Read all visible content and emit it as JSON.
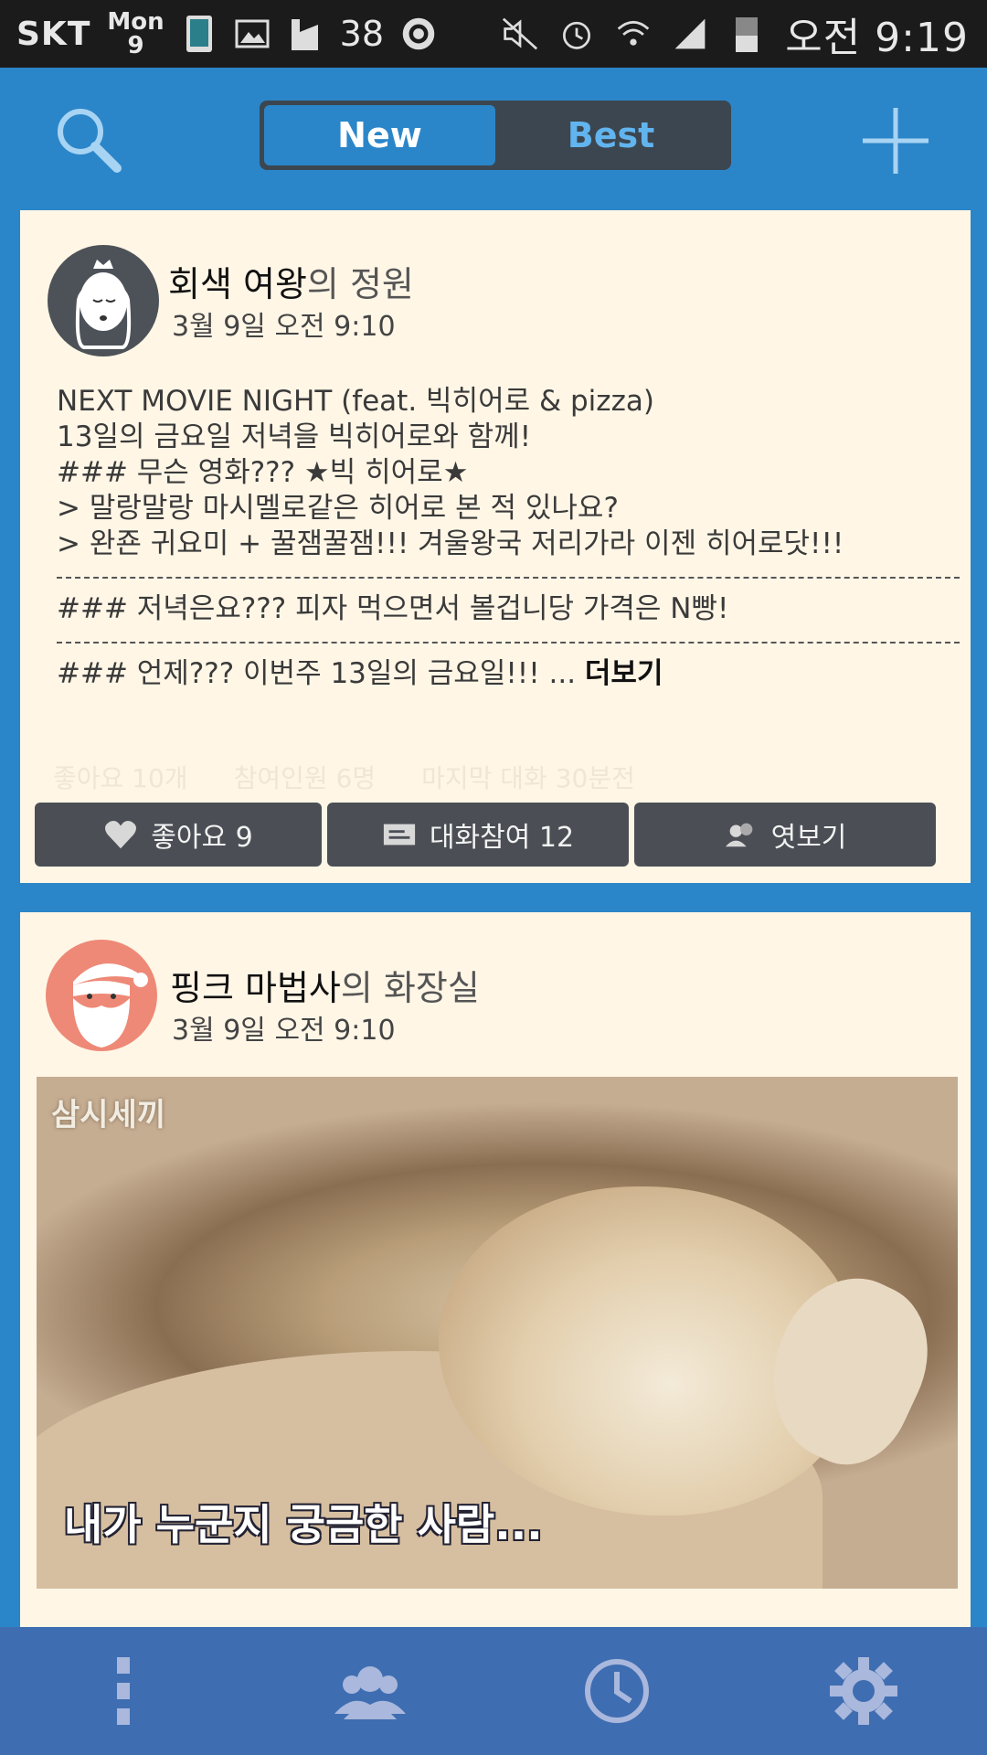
{
  "status_bar": {
    "carrier": "SKT",
    "day_name": "Mon",
    "day_num": "9",
    "badge_count": "38",
    "time": "오전 9:19"
  },
  "header": {
    "tabs": [
      {
        "label": "New",
        "active": true
      },
      {
        "label": "Best",
        "active": false
      }
    ],
    "search_icon": "search-icon",
    "add_icon": "plus-icon"
  },
  "posts": [
    {
      "title_user": "회색 여왕",
      "title_suffix": "의 정원",
      "date": "3월 9일 오전 9:10",
      "avatar": "queen-avatar",
      "body_lines": [
        "NEXT MOVIE NIGHT (feat. 빅히어로 & pizza)",
        "13일의 금요일 저녁을 빅히어로와 함께!",
        "### 무슨 영화??? ★빅 히어로★",
        "> 말랑말랑 마시멜로같은 히어로 본 적 있나요?",
        "> 완죤 귀요미 + 꿀잼꿀잼!!! 겨울왕국 저리가라 이젠 히어로닷!!!"
      ],
      "body_line_2": "### 저녁은요??? 피자 먹으면서 볼겁니당 가격은 N빵!",
      "body_line_3": "### 언제??? 이번주 13일의 금요일!!! ...",
      "more_label": "더보기",
      "stats": {
        "likes": "좋아요 10개",
        "participants": "참여인원 6명",
        "last_chat": "마지막 대화 30분전"
      },
      "actions": {
        "like": "좋아요 9",
        "chat": "대화참여 12",
        "peek": "엿보기"
      }
    },
    {
      "title_user": "핑크 마법사",
      "title_suffix": "의 화장실",
      "date": "3월 9일 오전 9:10",
      "avatar": "santa-avatar",
      "photo_logo": "삼시세끼",
      "photo_caption": "내가 누군지 궁금한 사람..."
    }
  ],
  "bottom_nav": [
    {
      "icon": "more-vertical-icon"
    },
    {
      "icon": "people-icon"
    },
    {
      "icon": "clock-icon"
    },
    {
      "icon": "gear-icon"
    }
  ],
  "colors": {
    "app_blue": "#2b86c9",
    "nav_blue": "#3f6db1",
    "card_bg": "#fff6e6",
    "button_dark": "#4b4f55",
    "avatar_coral": "#ee8977"
  }
}
